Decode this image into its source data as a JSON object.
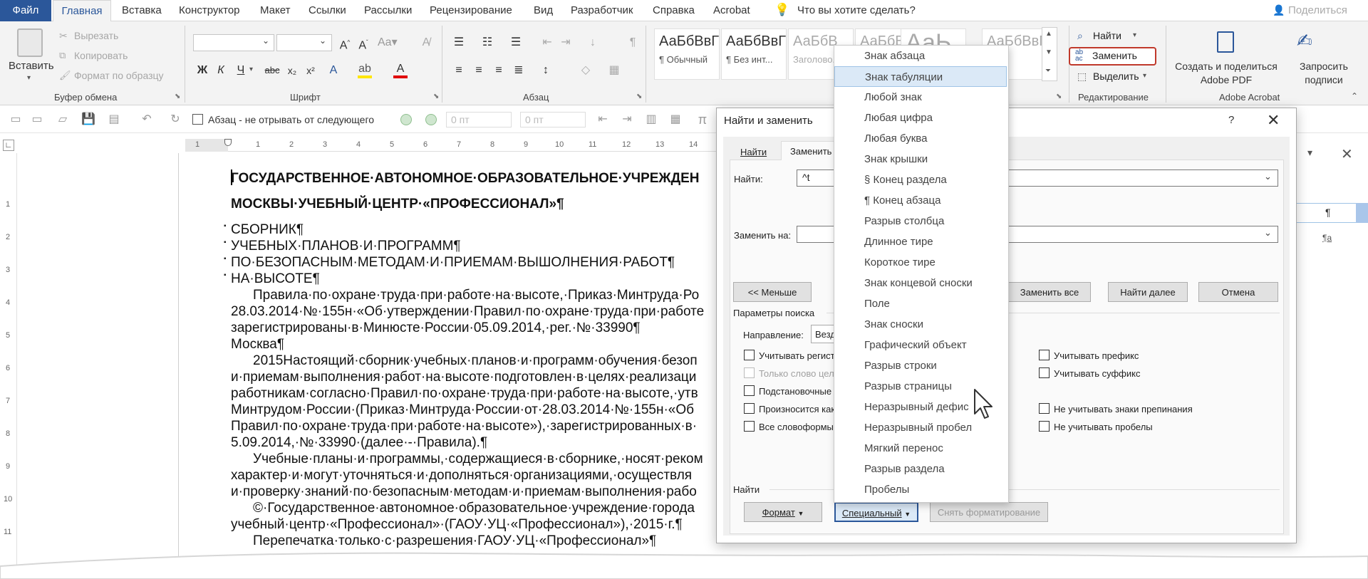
{
  "tabs": {
    "file": "Файл",
    "items": [
      "Главная",
      "Вставка",
      "Конструктор",
      "Макет",
      "Ссылки",
      "Рассылки",
      "Рецензирование",
      "Вид",
      "Разработчик",
      "Справка",
      "Acrobat"
    ],
    "active": "Главная",
    "tell_me": "Что вы хотите сделать?",
    "share": "Поделиться"
  },
  "ribbon": {
    "clipboard": {
      "title": "Буфер обмена",
      "paste": "Вставить",
      "cut": "Вырезать",
      "copy": "Копировать",
      "format_painter": "Формат по образцу"
    },
    "font": {
      "title": "Шрифт"
    },
    "paragraph": {
      "title": "Абзац"
    },
    "styles": {
      "items": [
        {
          "preview": "АаБбВвГ",
          "name": "¶ Обычный"
        },
        {
          "preview": "АаБбВвГ",
          "name": "¶ Без инт..."
        },
        {
          "preview": "АаБбВ",
          "name": "Заголово..."
        },
        {
          "preview": "АаБбВ",
          "name": ""
        },
        {
          "preview": "АаЬ",
          "name": ""
        },
        {
          "preview": "АаБбВвГ",
          "name": ""
        }
      ]
    },
    "editing": {
      "title": "Редактирование",
      "find": "Найти",
      "replace": "Заменить",
      "select": "Выделить"
    },
    "acrobat": {
      "title": "Adobe Acrobat",
      "create_pdf": "Создать и поделиться Adobe PDF",
      "request_sign": "Запросить подписи"
    }
  },
  "qat": {
    "keep_with_next": "Абзац - не отрывать от следующего",
    "space_before": "0 пт",
    "space_after": "0 пт"
  },
  "ruler": {
    "marks": [
      "1",
      "1",
      "2",
      "3",
      "4",
      "5",
      "6",
      "7",
      "8",
      "9",
      "10",
      "11",
      "12",
      "13",
      "14"
    ],
    "vmarks": [
      "1",
      "2",
      "3",
      "4",
      "5",
      "6",
      "7",
      "8",
      "9",
      "10",
      "11"
    ]
  },
  "document": {
    "lines": [
      {
        "text": "ГОСУДАРСТВЕННОЕ·АВТОНОМНОЕ·ОБРАЗОВАТЕЛЬНОЕ·УЧРЕЖДЕН",
        "bold": true
      },
      {
        "text": "МОСКВЫ·УЧЕБНЫЙ·ЦЕНТР·«ПРОФЕССИОНАЛ»¶",
        "bold": true
      },
      {
        "text": "СБОРНИК¶",
        "bold": false
      },
      {
        "text": "УЧЕБНЫХ·ПЛАНОВ·И·ПРОГРАММ¶",
        "bold": false
      },
      {
        "text": "ПО·БЕЗОПАСНЫМ·МЕТОДАМ·И·ПРИЕМАМ·ВЫШОЛНЕНИЯ·РАБОТ¶",
        "bold": false
      },
      {
        "text": "НА·ВЫСОТЕ¶",
        "bold": false
      },
      {
        "text": "Правила·по·охране·труда·при·работе·на·высоте,·Приказ·Минтруда·Ро",
        "bold": false
      },
      {
        "text": "28.03.2014·№·155н·«Об·утверждении·Правил·по·охране·труда·при·работе",
        "bold": false
      },
      {
        "text": "зарегистрированы·в·Минюсте·России·05.09.2014,·рег.·№·33990¶",
        "bold": false
      },
      {
        "text": "Москва¶",
        "bold": false
      },
      {
        "text": "2015Настоящий·сборник·учебных·планов·и·программ·обучения·безоп",
        "bold": false
      },
      {
        "text": "и·приемам·выполнения·работ·на·высоте·подготовлен·в·целях·реализаци",
        "bold": false
      },
      {
        "text": "работникам·согласно·Правил·по·охране·труда·при·работе·на·высоте,·утв",
        "bold": false
      },
      {
        "text": "Минтрудом·России·(Приказ·Минтруда·России·от·28.03.2014·№·155н·«Об",
        "bold": false
      },
      {
        "text": "Правил·по·охране·труда·при·работе·на·высоте»),·зарегистрированных·в·",
        "bold": false
      },
      {
        "text": "5.09.2014,·№·33990·(далее·-·Правила).¶",
        "bold": false
      },
      {
        "text": "Учебные·планы·и·программы,·содержащиеся·в·сборнике,·носят·реком",
        "bold": false
      },
      {
        "text": "характер·и·могут·уточняться·и·дополняться·организациями,·осуществля",
        "bold": false
      },
      {
        "text": "и·проверку·знаний·по·безопасным·методам·и·приемам·выполнения·рабо",
        "bold": false
      },
      {
        "text": "©·Государственное·автономное·образовательное·учреждение·города",
        "bold": false
      },
      {
        "text": "учебный·центр·«Профессионал»·(ГАОУ·УЦ·«Профессионал»),·2015·г.¶",
        "bold": false
      },
      {
        "text": "Перепечатка·только·с·разрешения·ГАОУ·УЦ·«Профессионал»¶",
        "bold": false
      }
    ]
  },
  "dialog": {
    "title": "Найти и заменить",
    "help": "?",
    "tabs": [
      "Найти",
      "Заменить"
    ],
    "find_label": "Найти:",
    "find_value": "^t",
    "replace_label": "Заменить на:",
    "replace_value": "",
    "less_button": "<< Меньше",
    "replace_all": "Заменить все",
    "find_next": "Найти далее",
    "cancel": "Отмена",
    "search_params": "Параметры поиска",
    "direction_label": "Направление:",
    "direction_value": "Везд",
    "options_left": [
      "Учитывать регистр",
      "Только слово цел",
      "Подстановочные",
      "Произносится как",
      "Все словоформы"
    ],
    "options_right": [
      "Учитывать префикс",
      "Учитывать суффикс",
      "Не учитывать знаки препинания",
      "Не учитывать пробелы"
    ],
    "find_section": "Найти",
    "format_button": "Формат",
    "special_button": "Специальный",
    "no_formatting": "Снять форматирование"
  },
  "side_pane": {
    "pilcrow": "¶",
    "small_pilcrow": "¶a"
  },
  "special_menu": {
    "items": [
      "Знак абзаца",
      "Знак табуляции",
      "Любой знак",
      "Любая цифра",
      "Любая буква",
      "Знак крышки",
      "§ Конец раздела",
      "¶ Конец абзаца",
      "Разрыв столбца",
      "Длинное тире",
      "Короткое тире",
      "Знак концевой сноски",
      "Поле",
      "Знак сноски",
      "Графический объект",
      "Разрыв строки",
      "Разрыв страницы",
      "Неразрывный дефис",
      "Неразрывный пробел",
      "Мягкий перенос",
      "Разрыв раздела",
      "Пробелы"
    ],
    "highlighted_index": 1
  },
  "colors": {
    "word_blue": "#2b579a",
    "highlight": "#dbe9f7",
    "replace_outline": "#c0392b"
  }
}
